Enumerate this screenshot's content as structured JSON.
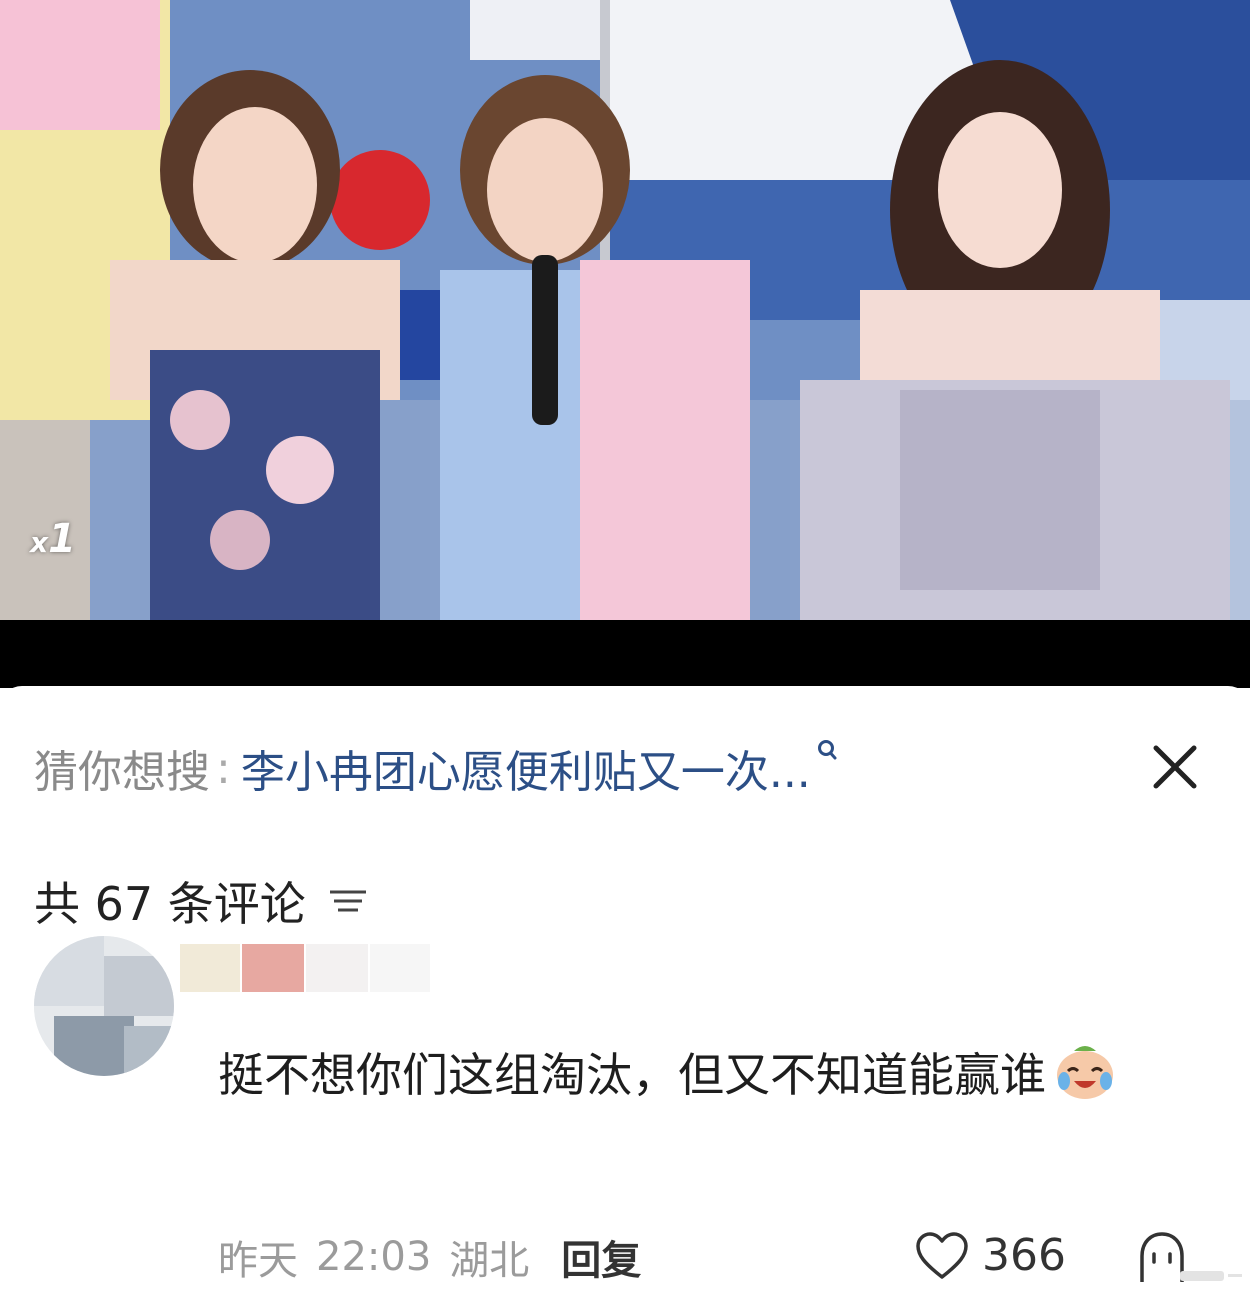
{
  "video": {
    "speed_prefix": "x",
    "speed_value": "1"
  },
  "suggestion": {
    "label": "猜你想搜",
    "separator": ":",
    "query": "李小冉团心愿便利贴又一次...",
    "search_icon": "search-icon",
    "close_icon": "close-icon"
  },
  "comments_header": {
    "count_text": "共 67 条评论",
    "sort_icon": "sort-icon"
  },
  "comment": {
    "text": "挺不想你们这组淘汰，但又不知道能赢谁",
    "emoji": "crying-laughing-emoji",
    "date": "昨天",
    "time": "22:03",
    "location": "湖北",
    "reply_label": "回复",
    "like_count": "366",
    "like_icon": "heart-icon",
    "dislike_icon": "dislike-icon"
  },
  "colors": {
    "link_blue": "#2c4f86",
    "muted_gray": "#9b9b9b"
  }
}
